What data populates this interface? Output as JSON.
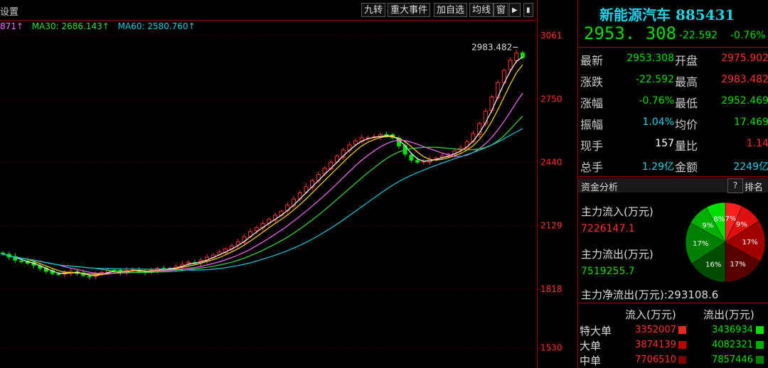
{
  "toolbar": {
    "settings_label": "设置",
    "buttons": [
      "九转",
      "重大事件",
      "加自选",
      "均线",
      "窗",
      "▶",
      "▮"
    ]
  },
  "ma_legend": {
    "ma_partial": "871↑",
    "ma30": "MA30: 2686.143↑",
    "ma60": "MA60: 2580.760↑"
  },
  "colors": {
    "up": "#ff3030",
    "down": "#00e000",
    "cyan": "#19d4e6",
    "ma5": "#ffffff",
    "ma10": "#ffd700",
    "ma20": "#ff66ff",
    "ma30": "#33dd33",
    "ma60": "#19c8e0"
  },
  "chart_data": {
    "type": "line",
    "description_type": "candlestick",
    "y_ticks": [
      "3061",
      "2750",
      "2440",
      "2129",
      "1818",
      "1530"
    ],
    "ylim": [
      1530,
      3100
    ],
    "high_label": "2983.482",
    "series_close": [
      1990,
      1975,
      1960,
      1955,
      1945,
      1935,
      1920,
      1905,
      1895,
      1890,
      1900,
      1905,
      1895,
      1885,
      1880,
      1890,
      1900,
      1910,
      1905,
      1900,
      1910,
      1915,
      1905,
      1900,
      1910,
      1920,
      1915,
      1920,
      1930,
      1940,
      1950,
      1945,
      1960,
      1975,
      1985,
      2000,
      2015,
      2030,
      2050,
      2075,
      2100,
      2120,
      2140,
      2160,
      2180,
      2200,
      2230,
      2260,
      2290,
      2320,
      2350,
      2380,
      2410,
      2440,
      2470,
      2500,
      2525,
      2545,
      2560,
      2560,
      2565,
      2575,
      2570,
      2560,
      2520,
      2480,
      2450,
      2440,
      2445,
      2455,
      2460,
      2470,
      2480,
      2495,
      2510,
      2540,
      2580,
      2630,
      2690,
      2760,
      2830,
      2890,
      2940,
      2975,
      2953
    ]
  },
  "right_panel": {
    "title": "新能源汽车 885431",
    "price": "2953. 308",
    "change": "-22.592",
    "change_pct": "-0.76%",
    "quotes": [
      {
        "k1": "最新",
        "v1": "2953.308",
        "c1": "green",
        "k2": "开盘",
        "v2": "2975.902",
        "c2": "red"
      },
      {
        "k1": "涨跌",
        "v1": "-22.592",
        "c1": "green",
        "k2": "最高",
        "v2": "2983.482",
        "c2": "red"
      },
      {
        "k1": "涨幅",
        "v1": "-0.76%",
        "c1": "green",
        "k2": "最低",
        "v2": "2952.469",
        "c2": "green"
      },
      {
        "k1": "振幅",
        "v1": "1.04%",
        "c1": "cyan",
        "k2": "均价",
        "v2": "17.469",
        "c2": "green"
      },
      {
        "k1": "现手",
        "v1": "157",
        "c1": "white",
        "k2": "量比",
        "v2": "1.14",
        "c2": "red"
      },
      {
        "k1": "总手",
        "v1": "1.29亿",
        "c1": "cyan",
        "k2": "金额",
        "v2": "2249亿",
        "c2": "cyan"
      }
    ],
    "fund": {
      "title": "资金分析",
      "help": "?",
      "rank": "排名",
      "inflow_label": "主力流入(万元)",
      "inflow_value": "7226147.1",
      "outflow_label": "主力流出(万元)",
      "outflow_value": "7519255.7",
      "net_label": "主力净流出(万元):293108.6",
      "pie": [
        {
          "label": "7%",
          "value": 7,
          "color": "#ff2020"
        },
        {
          "label": "9%",
          "value": 9,
          "color": "#e01010"
        },
        {
          "label": "17%",
          "value": 17,
          "color": "#a00000"
        },
        {
          "label": "17%",
          "value": 17,
          "color": "#5a0000"
        },
        {
          "label": "16%",
          "value": 16,
          "color": "#004d00"
        },
        {
          "label": "17%",
          "value": 17,
          "color": "#008000"
        },
        {
          "label": "9%",
          "value": 9,
          "color": "#00b000"
        },
        {
          "label": "8%",
          "value": 8,
          "color": "#00e000"
        }
      ]
    },
    "table": {
      "col_in": "流入(万元)",
      "col_out": "流出(万元)",
      "rows": [
        {
          "name": "特大单",
          "in": "3352007",
          "out": "3436934",
          "in_color": "#ff2020",
          "out_color": "#00e000"
        },
        {
          "name": "大单",
          "in": "3874139",
          "out": "4082321",
          "in_color": "#c00000",
          "out_color": "#00b000"
        },
        {
          "name": "中单",
          "in": "7706510",
          "out": "7857446",
          "in_color": "#800000",
          "out_color": "#008000"
        }
      ]
    }
  }
}
